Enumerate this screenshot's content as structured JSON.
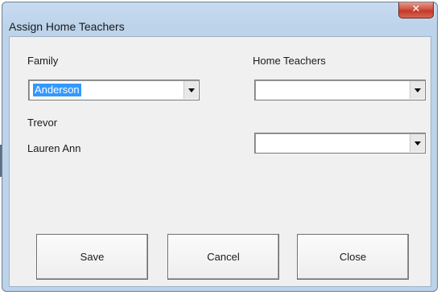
{
  "window": {
    "title": "Assign Home Teachers",
    "close_glyph": "✕"
  },
  "form": {
    "family_label": "Family",
    "family_selected": "Anderson",
    "home_teachers_label": "Home Teachers",
    "home_teacher_1_value": "",
    "home_teacher_2_value": "",
    "members": [
      "Trevor",
      "Lauren Ann"
    ]
  },
  "buttons": {
    "save_label": "Save",
    "cancel_label": "Cancel",
    "close_label": "Close"
  },
  "icons": {
    "close": "close-icon",
    "dropdown": "chevron-down-icon"
  },
  "colors": {
    "selection": "#3399ff",
    "close_button": "#c2382a",
    "frame": "#bcd3ea"
  }
}
